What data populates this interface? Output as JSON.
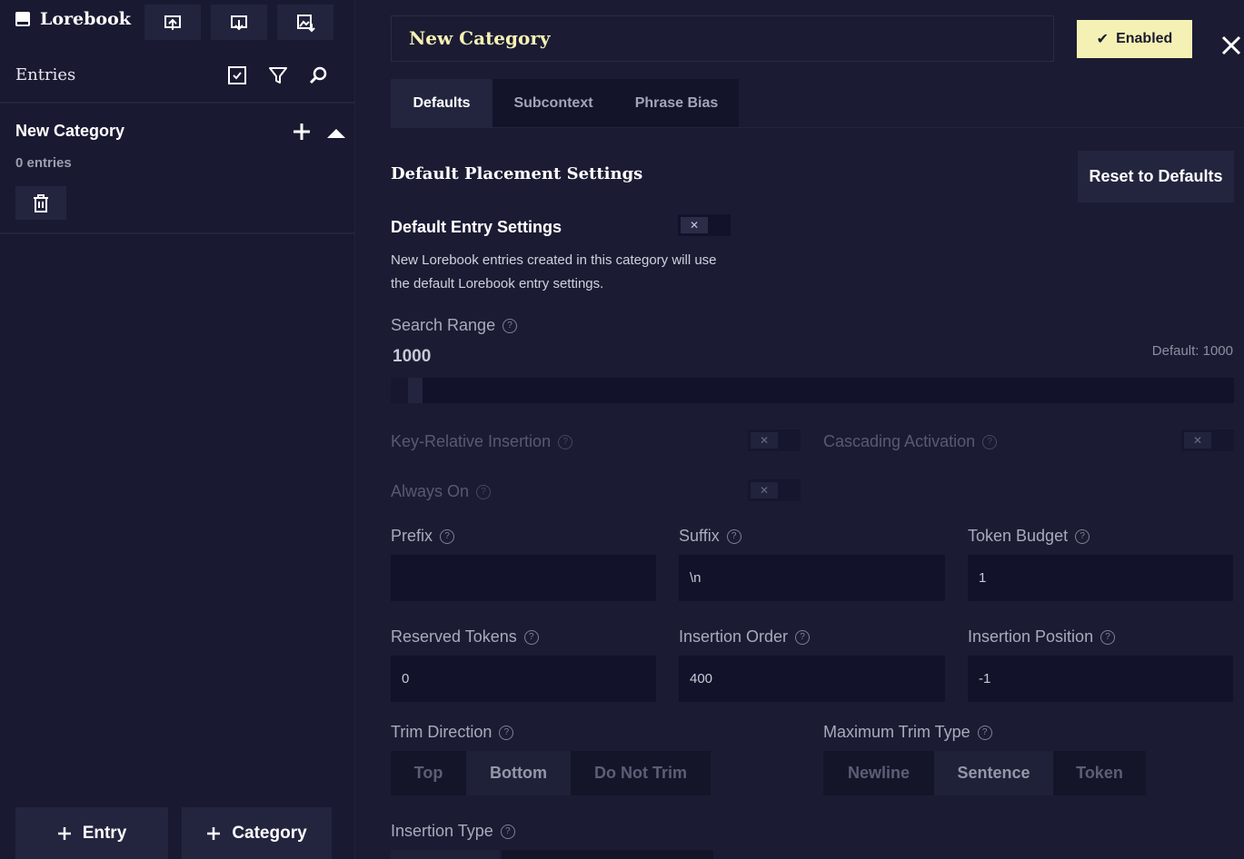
{
  "sidebar": {
    "title": "Lorebook",
    "header_buttons": [
      "import-icon",
      "export-icon",
      "image-import-icon"
    ],
    "entries_label": "Entries",
    "category": {
      "name": "New Category",
      "count": "0 entries"
    },
    "add_entry_label": "Entry",
    "add_category_label": "Category"
  },
  "main": {
    "category_name": "New Category",
    "enabled_label": "Enabled",
    "tabs": [
      {
        "label": "Defaults",
        "active": true
      },
      {
        "label": "Subcontext",
        "active": false
      },
      {
        "label": "Phrase Bias",
        "active": false
      }
    ],
    "section_title": "Default Placement Settings",
    "reset_label": "Reset to Defaults",
    "default_entry": {
      "title": "Default Entry Settings",
      "description": "New Lorebook entries created in this category will use the default Lorebook entry settings."
    },
    "search_range": {
      "label": "Search Range",
      "value": "1000",
      "default_text": "Default: 1000",
      "fraction": 0.02
    },
    "key_relative_label": "Key-Relative Insertion",
    "cascading_label": "Cascading Activation",
    "always_on_label": "Always On",
    "fields": {
      "prefix": {
        "label": "Prefix",
        "value": ""
      },
      "suffix": {
        "label": "Suffix",
        "value": "\\n"
      },
      "token_budget": {
        "label": "Token Budget",
        "value": "1"
      },
      "reserved_tokens": {
        "label": "Reserved Tokens",
        "value": "0"
      },
      "insertion_order": {
        "label": "Insertion Order",
        "value": "400"
      },
      "insertion_position": {
        "label": "Insertion Position",
        "value": "-1"
      }
    },
    "trim_direction": {
      "label": "Trim Direction",
      "options": [
        "Top",
        "Bottom",
        "Do Not Trim"
      ],
      "selected": "Bottom"
    },
    "max_trim_type": {
      "label": "Maximum Trim Type",
      "options": [
        "Newline",
        "Sentence",
        "Token"
      ],
      "selected": "Sentence"
    },
    "insertion_type_label": "Insertion Type"
  },
  "colors": {
    "accent": "#f5f1b4",
    "background": "#1b1c33",
    "sidebar": "#191a31",
    "button": "#23253f"
  }
}
